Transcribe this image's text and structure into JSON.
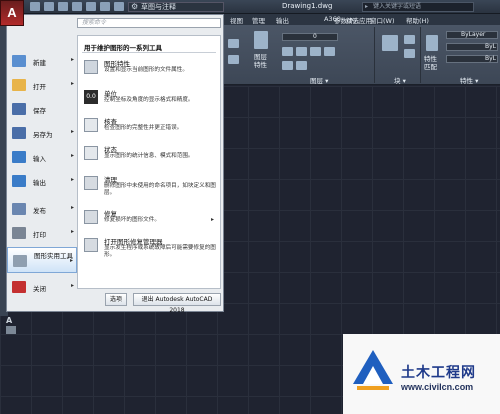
{
  "window": {
    "app_letter": "A",
    "workspace": "草图与注释",
    "title": "Drawing1.dwg",
    "search_placeholder": "键入关键字或短语"
  },
  "ribbon": {
    "tabs": [
      "视图",
      "管理",
      "输出",
      "A360",
      "精选应用"
    ],
    "tabs_right": [
      "参数(P)",
      "窗口(W)",
      "帮助(H)"
    ],
    "panel_labels": {
      "layer_props": "图层\n特性",
      "layer": "图层 ▾",
      "block": "块 ▾",
      "match_props": "特性\n匹配",
      "props": "特性 ▾",
      "bylayer1": "ByLayer",
      "bylayer2": "ByL",
      "bylayer3": "ByL",
      "layer_value": "0"
    }
  },
  "appmenu": {
    "search_placeholder": "搜索命令",
    "items": [
      {
        "label": "新建",
        "arrow": "▸",
        "icon": "new-file-icon",
        "color": "#5a8fd0"
      },
      {
        "label": "打开",
        "arrow": "▸",
        "icon": "open-folder-icon",
        "color": "#e8b44a"
      },
      {
        "label": "保存",
        "arrow": "",
        "icon": "save-icon",
        "color": "#4a6ea8"
      },
      {
        "label": "另存为",
        "arrow": "▸",
        "icon": "save-as-icon",
        "color": "#4a6ea8"
      },
      {
        "label": "输入",
        "arrow": "▸",
        "icon": "import-icon",
        "color": "#3a7cc8"
      },
      {
        "label": "输出",
        "arrow": "▸",
        "icon": "export-icon",
        "color": "#3a7cc8"
      },
      {
        "label": "发布",
        "arrow": "▸",
        "icon": "publish-icon",
        "color": "#6a86b0"
      },
      {
        "label": "打印",
        "arrow": "▸",
        "icon": "print-icon",
        "color": "#7a8594"
      },
      {
        "label": "图形实用工具",
        "arrow": "▸",
        "icon": "drawing-utilities-icon",
        "color": "#8f9fb0"
      },
      {
        "label": "关闭",
        "arrow": "▸",
        "icon": "close-file-icon",
        "color": "#c43030"
      }
    ],
    "submenu": {
      "heading": "用于维护图形的一系列工具",
      "items": [
        {
          "title": "图形特性",
          "desc": "设置和显示当前图形的文件属性。",
          "icon": "drawing-properties-icon",
          "arrow": ""
        },
        {
          "title": "单位",
          "desc": "控制坐标及角度的显示格式和精度。",
          "icon": "units-icon",
          "arrow": ""
        },
        {
          "title": "核查",
          "desc": "检查图形的完整性并更正错误。",
          "icon": "audit-icon",
          "arrow": ""
        },
        {
          "title": "状态",
          "desc": "显示图形的统计信息、模式和范围。",
          "icon": "status-icon",
          "arrow": ""
        },
        {
          "title": "清理",
          "desc": "删除图形中未使用的命名项目，如块定义和图层。",
          "icon": "purge-icon",
          "arrow": ""
        },
        {
          "title": "修复",
          "desc": "修复损坏的图形文件。",
          "icon": "repair-icon",
          "arrow": "▸"
        },
        {
          "title": "打开图形修复管理器",
          "desc": "显示发生程序或系统故障后可能需要修复的图形。",
          "icon": "recovery-manager-icon",
          "arrow": ""
        }
      ]
    },
    "buttons": {
      "options": "选项",
      "exit": "退出 Autodesk AutoCAD 2018"
    }
  },
  "canvas": {
    "ucs_label": "A"
  },
  "watermark": {
    "title": "土木工程网",
    "url": "www.civilcn.com"
  }
}
